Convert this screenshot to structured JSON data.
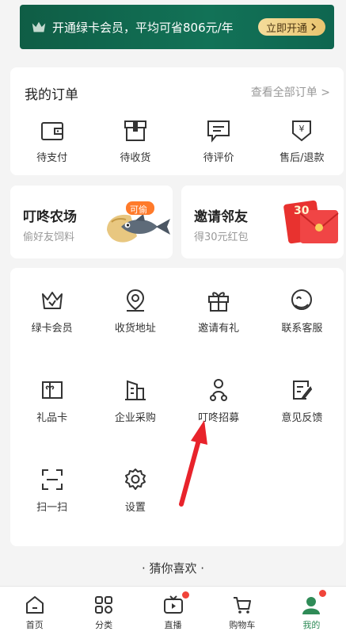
{
  "member_banner": {
    "text": "开通绿卡会员，平均可省806元/年",
    "button_label": "立即开通"
  },
  "orders": {
    "title": "我的订单",
    "view_all": "查看全部订单 >",
    "items": [
      {
        "label": "待支付",
        "icon": "wallet-icon"
      },
      {
        "label": "待收货",
        "icon": "package-icon"
      },
      {
        "label": "待评价",
        "icon": "comment-icon"
      },
      {
        "label": "售后/退款",
        "icon": "refund-icon"
      }
    ]
  },
  "farm": {
    "title": "叮咚农场",
    "subtitle": "偷好友饲料",
    "badge": "可偷"
  },
  "invite": {
    "title": "邀请邻友",
    "subtitle": "得30元红包",
    "envelope_amount": "30"
  },
  "services": [
    {
      "label": "绿卡会员",
      "icon": "crown-icon"
    },
    {
      "label": "收货地址",
      "icon": "location-icon"
    },
    {
      "label": "邀请有礼",
      "icon": "gift-icon"
    },
    {
      "label": "联系客服",
      "icon": "customer-service-icon"
    },
    {
      "label": "礼品卡",
      "icon": "gift-card-icon"
    },
    {
      "label": "企业采购",
      "icon": "building-icon"
    },
    {
      "label": "叮咚招募",
      "icon": "rider-icon"
    },
    {
      "label": "意见反馈",
      "icon": "feedback-icon"
    },
    {
      "label": "扫一扫",
      "icon": "scan-icon"
    },
    {
      "label": "设置",
      "icon": "settings-icon"
    }
  ],
  "guess": "· 猜你喜欢 ·",
  "tabbar": [
    {
      "label": "首页",
      "icon": "home-icon"
    },
    {
      "label": "分类",
      "icon": "category-icon"
    },
    {
      "label": "直播",
      "icon": "live-icon"
    },
    {
      "label": "购物车",
      "icon": "cart-icon"
    },
    {
      "label": "我的",
      "icon": "profile-icon"
    }
  ],
  "colors": {
    "brand_green": "#2f8b57",
    "banner_green": "#127257",
    "badge_red": "#f0443a",
    "annotation_arrow": "#e8232b"
  }
}
